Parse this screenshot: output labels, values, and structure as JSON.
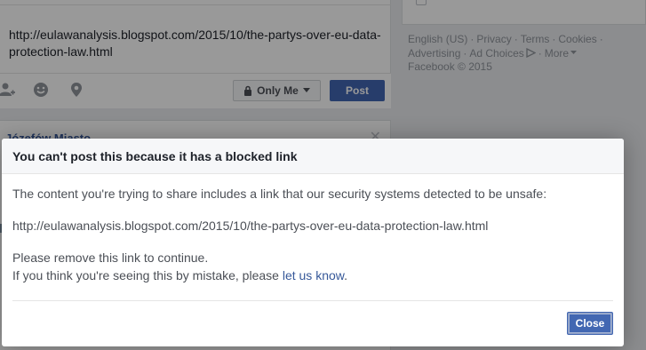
{
  "composer": {
    "text": "http://eulawanalysis.blogspot.com/2015/10/the-partys-over-eu-data-protection-law.html",
    "icons": {
      "friend": "tag-friend-icon",
      "feeling": "smiley-icon",
      "location": "location-pin-icon"
    },
    "privacy_label": "Only Me",
    "post_label": "Post"
  },
  "card2": {
    "name": "Józefów Miasto"
  },
  "right_footer": {
    "links": [
      "English (US)",
      "Privacy",
      "Terms",
      "Cookies",
      "Advertising",
      "Ad Choices",
      "More"
    ],
    "copyright": "Facebook © 2015"
  },
  "dialog": {
    "title": "You can't post this because it has a blocked link",
    "message": "The content you're trying to share includes a link that our security systems detected to be unsafe:",
    "url": "http://eulawanalysis.blogspot.com/2015/10/the-partys-over-eu-data-protection-law.html",
    "instruction": "Please remove this link to continue.",
    "mistake_prefix": "If you think you're seeing this by mistake, please ",
    "mistake_link": "let us know",
    "mistake_suffix": ".",
    "close_label": "Close"
  },
  "colors": {
    "brand": "#4267b2",
    "link": "#365899",
    "background": "#e9ebee"
  }
}
